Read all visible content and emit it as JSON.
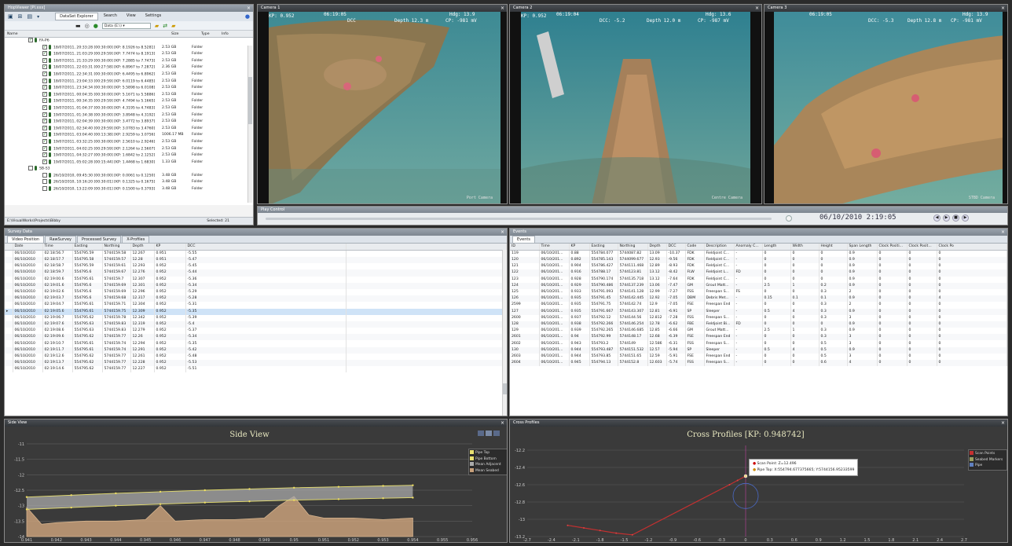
{
  "app": {
    "title": "HopViewer [Pl.xxx]"
  },
  "toolbar": {
    "tabs": [
      "DataSet Explorer",
      "Search",
      "View",
      "Settings"
    ],
    "dataset_select": "Data (E:\\)"
  },
  "tree": {
    "headers": [
      "Name",
      "Size",
      "Type",
      "Info"
    ],
    "groups": [
      {
        "label": "FA-P6",
        "rows": [
          [
            "18/07/2011, 20:33:28 [00:30:00] [KP: 8.1926 to 8.5281]",
            "2.53 GB",
            "Folder"
          ],
          [
            "18/07/2011, 21:03:29 [00:29:59] [KP: 7.7474 to 8.1913]",
            "2.53 GB",
            "Folder"
          ],
          [
            "18/07/2011, 21:33:29 [00:30:00] [KP: 7.2885 to 7.7473]",
            "2.53 GB",
            "Folder"
          ],
          [
            "18/07/2011, 22:03:31 [00:27:58] [KP: 6.8967 to 7.2872]",
            "2.36 GB",
            "Folder"
          ],
          [
            "18/07/2011, 22:34:31 [00:30:00] [KP: 6.4495 to 6.8962]",
            "2.53 GB",
            "Folder"
          ],
          [
            "18/07/2011, 23:04:33 [00:29:59] [KP: 6.0119 to 6.4485]",
            "2.53 GB",
            "Folder"
          ],
          [
            "18/07/2011, 23:34:34 [00:30:00] [KP: 5.5898 to 6.0108]",
            "2.53 GB",
            "Folder"
          ],
          [
            "19/07/2011, 00:04:35 [00:30:00] [KP: 5.1671 to 5.5886]",
            "2.53 GB",
            "Folder"
          ],
          [
            "19/07/2011, 00:34:35 [00:29:59] [KP: 4.7494 to 5.1665]",
            "2.53 GB",
            "Folder"
          ],
          [
            "19/07/2011, 01:04:37 [00:30:00] [KP: 4.3195 to 4.7483]",
            "2.53 GB",
            "Folder"
          ],
          [
            "19/07/2011, 01:34:38 [00:30:00] [KP: 3.8948 to 4.3192]",
            "2.53 GB",
            "Folder"
          ],
          [
            "19/07/2011, 02:04:39 [00:30:00] [KP: 3.4772 to 3.8937]",
            "2.53 GB",
            "Folder"
          ],
          [
            "19/07/2011, 02:34:40 [00:29:59] [KP: 3.0783 to 3.4760]",
            "2.53 GB",
            "Folder"
          ],
          [
            "19/07/2011, 03:04:40 [00:13:38] [KP: 2.9259 to 3.0756]",
            "1006.17 MB",
            "Folder"
          ],
          [
            "19/07/2011, 03:32:25 [00:30:00] [KP: 2.5610 to 2.9246]",
            "2.53 GB",
            "Folder"
          ],
          [
            "19/07/2011, 04:02:25 [00:29:59] [KP: 2.1264 to 2.5607]",
            "2.53 GB",
            "Folder"
          ],
          [
            "19/07/2011, 04:32:27 [00:30:00] [KP: 1.6842 to 2.1252]",
            "2.53 GB",
            "Folder"
          ],
          [
            "19/07/2011, 05:02:28 [00:15:44] [KP: 1.4468 to 1.6830]",
            "1.33 GB",
            "Folder"
          ]
        ]
      },
      {
        "label": "SB-S3",
        "rows": [
          [
            "26/10/2010, 09:45:30 [00:30:00] [KP: 0.0061 to 0.1250]",
            "3.48 GB",
            "Folder"
          ],
          [
            "26/10/2010, 10:16:20 [00:30:01] [KP: 0.1325 to 0.1675]",
            "3.48 GB",
            "Folder"
          ],
          [
            "26/10/2010, 13:22:09 [00:30:01] [KP: 0.1500 to 0.3793]",
            "3.48 GB",
            "Folder"
          ]
        ]
      }
    ],
    "path": "E:\\VisualWorks\\Projects\\Bibby",
    "selected": "Selected: 21"
  },
  "cameras": [
    {
      "title": "Camera 1",
      "time": "06:19:05",
      "kp": "KP: 0.952",
      "dcc": "DCC",
      "depth": "Depth 12.3 m",
      "cp": "CP: -981 mV",
      "hdg": "Hdg: 13.9",
      "label": "Port Camera"
    },
    {
      "title": "Camera 2",
      "time": "06:19:04",
      "kp": "KP: 0.952",
      "dcc": "DCC: -5.2",
      "depth": "Depth 12.0 m",
      "cp": "CP: -987 mV",
      "hdg": "Hdg: 13.6",
      "label": "Centre Camera"
    },
    {
      "title": "Camera 3",
      "time": "06:19:05",
      "kp": "",
      "dcc": "DCC: -5.3",
      "depth": "Depth 12.8 m",
      "cp": "CP: -981 mV",
      "hdg": "Hdg: 13.9",
      "label": "STBD Camera"
    }
  ],
  "playback": {
    "title": "Play Control",
    "datetime": "06/10/2010  2:19:05"
  },
  "survey": {
    "title": "Survey Data",
    "tabs": [
      "Video Position",
      "RawSurvey",
      "Processed Survey",
      "X-Profiles"
    ],
    "headers": [
      "Date",
      "Time",
      "Easting",
      "Northing",
      "Depth",
      "KP",
      "DCC"
    ],
    "rows": [
      [
        "06/10/2010",
        "02:18:56.7",
        "554795.59",
        "5744159.58",
        "12.267",
        "0.951",
        "-5.55"
      ],
      [
        "06/10/2010",
        "02:18:57.7",
        "554795.58",
        "5744159.57",
        "12.28",
        "0.951",
        "-5.47"
      ],
      [
        "06/10/2010",
        "02:18:58.7",
        "554795.59",
        "5744159.61",
        "12.293",
        "0.952",
        "-5.45"
      ],
      [
        "06/10/2010",
        "02:18:59.7",
        "554795.6",
        "5744159.67",
        "12.276",
        "0.952",
        "-5.44"
      ],
      [
        "06/10/2010",
        "02:19:00.6",
        "554795.61",
        "5744159.7",
        "12.307",
        "0.952",
        "-5.36"
      ],
      [
        "06/10/2010",
        "02:19:01.6",
        "554795.6",
        "5744159.69",
        "12.301",
        "0.952",
        "-5.34"
      ],
      [
        "06/10/2010",
        "02:19:02.6",
        "554795.6",
        "5744159.69",
        "12.296",
        "0.952",
        "-5.29"
      ],
      [
        "06/10/2010",
        "02:19:03.7",
        "554795.6",
        "5744159.68",
        "12.317",
        "0.952",
        "-5.28"
      ],
      [
        "06/10/2010",
        "02:19:04.7",
        "554795.61",
        "5744159.71",
        "12.304",
        "0.952",
        "-5.31"
      ],
      [
        "06/10/2010",
        "02:19:05.6",
        "554795.61",
        "5744159.75",
        "12.309",
        "0.952",
        "-5.35"
      ],
      [
        "06/10/2010",
        "02:19:06.7",
        "554795.62",
        "5744159.78",
        "12.342",
        "0.952",
        "-5.39"
      ],
      [
        "06/10/2010",
        "02:19:07.6",
        "554795.63",
        "5744159.83",
        "12.319",
        "0.952",
        "-5.4"
      ],
      [
        "06/10/2010",
        "02:19:08.6",
        "554795.63",
        "5744159.83",
        "12.279",
        "0.952",
        "-5.37"
      ],
      [
        "06/10/2010",
        "02:19:09.6",
        "554795.62",
        "5744159.77",
        "12.26",
        "0.952",
        "-5.34"
      ],
      [
        "06/10/2010",
        "02:19:10.7",
        "554795.61",
        "5744159.74",
        "12.294",
        "0.952",
        "-5.35"
      ],
      [
        "06/10/2010",
        "02:19:11.7",
        "554795.61",
        "5744159.74",
        "12.291",
        "0.952",
        "-5.42"
      ],
      [
        "06/10/2010",
        "02:19:12.6",
        "554795.62",
        "5744159.77",
        "12.261",
        "0.952",
        "-5.48"
      ],
      [
        "06/10/2010",
        "02:19:13.7",
        "554795.62",
        "5744159.77",
        "12.228",
        "0.952",
        "-5.53"
      ],
      [
        "06/10/2010",
        "02:19:14.6",
        "554795.62",
        "5744159.77",
        "12.227",
        "0.952",
        "-5.51"
      ]
    ],
    "selected_index": 9
  },
  "events": {
    "title": "Events",
    "tab": "Events",
    "headers": [
      "ID",
      "Time",
      "KP",
      "Easting",
      "Northing",
      "Depth",
      "DCC",
      "Code",
      "Description",
      "Anomaly C...",
      "Length",
      "Width",
      "Height",
      "Span Length",
      "Clock Positi...",
      "Clock Posit...",
      "Clock Po"
    ],
    "rows": [
      [
        "119",
        "06/10/201...",
        "0.88",
        "554784.077",
        "5744087.82",
        "13.09",
        "-10.37",
        "FDK",
        "Fieldjoint C...",
        "-",
        "0",
        "0",
        "0",
        "0.9",
        "0",
        "0",
        "0"
      ],
      [
        "120",
        "06/10/201...",
        "0.892",
        "554785.143",
        "5744099.677",
        "12.93",
        "-9.56",
        "FDK",
        "Fieldjoint C...",
        "-",
        "0",
        "0",
        "0",
        "0.9",
        "0",
        "0",
        "0"
      ],
      [
        "121",
        "06/10/201...",
        "0.904",
        "554786.427",
        "5744111.468",
        "12.89",
        "-8.93",
        "FDK",
        "Fieldjoint C...",
        "-",
        "0",
        "0",
        "0",
        "0.9",
        "0",
        "0",
        "0"
      ],
      [
        "122",
        "06/10/201...",
        "0.916",
        "554788.17",
        "5744123.81",
        "13.12",
        "-8.42",
        "FLW",
        "Fieldjoint L...",
        "FD",
        "0",
        "0",
        "0",
        "0.9",
        "0",
        "0",
        "0"
      ],
      [
        "123",
        "06/10/201...",
        "0.928",
        "554790.174",
        "5744135.718",
        "13.12",
        "-7.64",
        "FDK",
        "Fieldjoint C...",
        "-",
        "0",
        "0",
        "0",
        "0.9",
        "0",
        "0",
        "0"
      ],
      [
        "124",
        "06/10/201...",
        "0.929",
        "554790.486",
        "5744137.239",
        "13.06",
        "-7.47",
        "GM",
        "Grout Matt...",
        "-",
        "2.5",
        "1",
        "0.2",
        "0.9",
        "0",
        "0",
        "0"
      ],
      [
        "125",
        "06/10/201...",
        "0.933",
        "554791.093",
        "5744141.128",
        "12.99",
        "-7.27",
        "FSS",
        "Freespan S...",
        "FS",
        "0",
        "0",
        "0.3",
        "2",
        "0",
        "0",
        "0"
      ],
      [
        "126",
        "06/10/201...",
        "0.935",
        "554791.45",
        "5744142.445",
        "12.92",
        "-7.05",
        "DBM",
        "Debris Met...",
        "-",
        "0.15",
        "0.1",
        "0.1",
        "0.9",
        "0",
        "0",
        "4"
      ],
      [
        "2599",
        "06/10/201...",
        "0.935",
        "554791.75",
        "5744142.74",
        "12.9",
        "-7.05",
        "FSE",
        "Freespan End",
        "-",
        "0",
        "0",
        "0.3",
        "2",
        "0",
        "0",
        "0"
      ],
      [
        "127",
        "06/10/201...",
        "0.935",
        "554791.667",
        "5744143.307",
        "12.81",
        "-6.91",
        "SP",
        "Sleeper",
        "-",
        "0.5",
        "4",
        "0.3",
        "0.9",
        "0",
        "0",
        "0"
      ],
      [
        "2600",
        "06/10/201...",
        "0.937",
        "554792.12",
        "5744144.56",
        "12.812",
        "-7.28",
        "FSS",
        "Freespan S...",
        "-",
        "0",
        "0",
        "0.3",
        "3",
        "0",
        "0",
        "0"
      ],
      [
        "128",
        "06/10/201...",
        "0.938",
        "554792.266",
        "5744146.254",
        "12.78",
        "-6.62",
        "FBE",
        "Fieldjoint Bi...",
        "FD",
        "0",
        "0",
        "0",
        "0.9",
        "0",
        "0",
        "0"
      ],
      [
        "129",
        "06/10/201...",
        "0.939",
        "554792.265",
        "5744146.685",
        "12.85",
        "-6.66",
        "GM",
        "Grout Matt...",
        "-",
        "2.5",
        "1",
        "0.3",
        "0.9",
        "0",
        "0",
        "0"
      ],
      [
        "2601",
        "06/10/201...",
        "0.94",
        "554792.99",
        "5744148.17",
        "12.68",
        "-6.39",
        "FSE",
        "Freespan End",
        "-",
        "0",
        "0",
        "0.3",
        "3",
        "0",
        "0",
        "0"
      ],
      [
        "2602",
        "06/10/201...",
        "0.943",
        "554793.2",
        "5744149",
        "12.586",
        "-6.31",
        "FSS",
        "Freespan S...",
        "-",
        "0",
        "0",
        "0.5",
        "3",
        "0",
        "0",
        "0"
      ],
      [
        "130",
        "06/10/201...",
        "0.944",
        "554793.487",
        "5744151.532",
        "12.57",
        "-5.94",
        "SP",
        "Sleeper",
        "-",
        "0.5",
        "4",
        "0.5",
        "0.9",
        "0",
        "0",
        "0"
      ],
      [
        "2603",
        "06/10/201...",
        "0.944",
        "554793.85",
        "5744151.65",
        "12.59",
        "-5.91",
        "FSE",
        "Freespan End",
        "-",
        "0",
        "0",
        "0.5",
        "3",
        "0",
        "0",
        "0"
      ],
      [
        "2604",
        "06/10/201...",
        "0.945",
        "554794.13",
        "5744152.8",
        "12.603",
        "-5.74",
        "FSS",
        "Freespan S...",
        "-",
        "0",
        "0",
        "0.6",
        "4",
        "0",
        "0",
        "0"
      ]
    ]
  },
  "side_view": {
    "panel_title": "Side View",
    "legend": [
      "Pipe Top",
      "Pipe Bottom",
      "Mean Adjacent",
      "Mean Seabed"
    ]
  },
  "cross_profiles": {
    "panel_title": "Cross Profiles",
    "legend": [
      "Scan Points",
      "Seabed Markers",
      "Pipe"
    ],
    "tooltip": [
      "Scan Point: Z=12.496",
      "Pipe Top: X:554794.677375665; Y:5744156.95233599"
    ]
  },
  "chart_data": [
    {
      "type": "area",
      "title": "Side View",
      "xlim": [
        0.941,
        0.956
      ],
      "ylim": [
        -14,
        -11
      ],
      "x_ticks": [
        "0.941",
        "0.942",
        "0.943",
        "0.944",
        "0.945",
        "0.946",
        "0.947",
        "0.948",
        "0.949",
        "0.95",
        "0.951",
        "0.952",
        "0.953",
        "0.954",
        "0.955",
        "0.956"
      ],
      "y_ticks": [
        "-11",
        "-11.5",
        "-12",
        "-12.5",
        "-13",
        "-13.5",
        "-14"
      ],
      "series": [
        {
          "name": "Pipe Top",
          "x": [
            0.941,
            0.9425,
            0.944,
            0.9455,
            0.947,
            0.9485,
            0.95,
            0.9515,
            0.953,
            0.954
          ],
          "values": [
            -12.72,
            -12.66,
            -12.6,
            -12.55,
            -12.5,
            -12.46,
            -12.42,
            -12.39,
            -12.36,
            -12.34
          ]
        },
        {
          "name": "Pipe Bottom",
          "x": [
            0.941,
            0.9425,
            0.944,
            0.9455,
            0.947,
            0.9485,
            0.95,
            0.9515,
            0.953,
            0.954
          ],
          "values": [
            -13.12,
            -13.06,
            -13.0,
            -12.95,
            -12.9,
            -12.86,
            -12.82,
            -12.79,
            -12.76,
            -12.74
          ]
        },
        {
          "name": "Mean Seabed",
          "x": [
            0.941,
            0.9415,
            0.942,
            0.943,
            0.944,
            0.945,
            0.9455,
            0.946,
            0.947,
            0.948,
            0.949,
            0.9495,
            0.95,
            0.9505,
            0.951,
            0.952,
            0.953,
            0.954
          ],
          "values": [
            -13.05,
            -13.6,
            -13.55,
            -13.5,
            -13.5,
            -13.45,
            -13.0,
            -13.5,
            -13.45,
            -13.45,
            -13.4,
            -13.0,
            -12.7,
            -13.3,
            -13.4,
            -13.4,
            -13.45,
            -13.4
          ]
        }
      ]
    },
    {
      "type": "scatter",
      "title": "Cross Profiles [KP: 0.948742]",
      "xlim": [
        -2.7,
        2.7
      ],
      "ylim": [
        -13.2,
        -12.2
      ],
      "x_ticks": [
        "-2.7",
        "-2.4",
        "-2.1",
        "-1.8",
        "-1.5",
        "-1.2",
        "-0.9",
        "-0.6",
        "-0.3",
        "0",
        "0.3",
        "0.6",
        "0.9",
        "1.2",
        "1.5",
        "1.8",
        "2.1",
        "2.4",
        "2.7"
      ],
      "y_ticks": [
        "-12.2",
        "-12.4",
        "-12.6",
        "-12.8",
        "-13",
        "-13.2"
      ],
      "series": [
        {
          "name": "Scan Points",
          "x": [
            -2.2,
            -2.0,
            -1.8,
            -1.6,
            -1.4,
            -0.2,
            -0.1,
            0.0
          ],
          "values": [
            -13.07,
            -13.1,
            -13.13,
            -13.16,
            -13.18,
            -12.6,
            -12.55,
            -12.5
          ]
        },
        {
          "name": "Pipe",
          "x": [
            0.0
          ],
          "values": [
            -12.73
          ]
        }
      ]
    }
  ]
}
